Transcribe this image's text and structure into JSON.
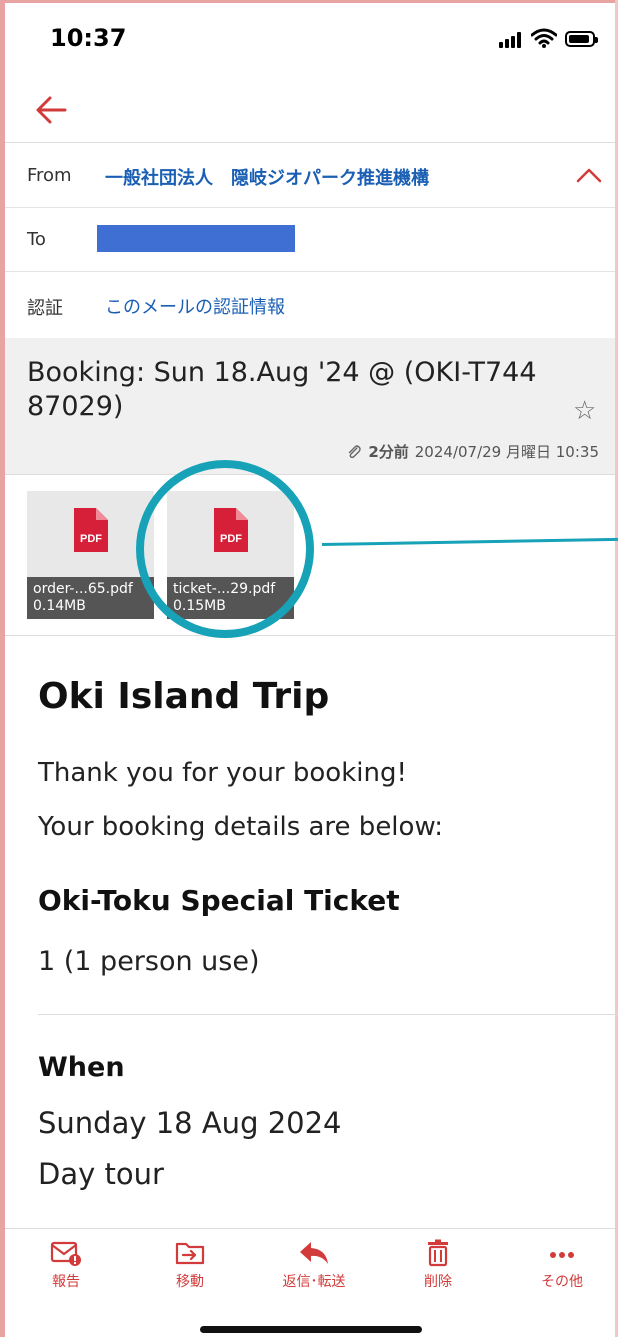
{
  "status_bar": {
    "time": "10:37"
  },
  "email_header": {
    "from_label": "From",
    "from_value": "一般社団法人　隠岐ジオパーク推進機構",
    "to_label": "To",
    "auth_label": "認証",
    "auth_link": "このメールの認証情報"
  },
  "subject": {
    "text": "Booking: Sun 18.Aug '24 @  (OKI-T74487029)",
    "time_ago": "2分前",
    "datetime": "2024/07/29 月曜日 10:35"
  },
  "attachments": [
    {
      "icon_label": "PDF",
      "name": "order-...65.pdf",
      "size": "0.14MB"
    },
    {
      "icon_label": "PDF",
      "name": "ticket-...29.pdf",
      "size": "0.15MB"
    }
  ],
  "body": {
    "title": "Oki Island Trip",
    "thanks": "Thank you for your booking!",
    "details_intro": "Your booking details are below:",
    "ticket_name": "Oki-Toku Special Ticket",
    "quantity": "1 (1 person use)",
    "when_heading": "When",
    "date": "Sunday 18 Aug 2024",
    "tour_type": "Day tour"
  },
  "toolbar": [
    {
      "label": "報告",
      "icon": "report-mail-icon"
    },
    {
      "label": "移動",
      "icon": "move-folder-icon"
    },
    {
      "label": "返信･転送",
      "icon": "reply-icon"
    },
    {
      "label": "削除",
      "icon": "trash-icon"
    },
    {
      "label": "その他",
      "icon": "more-dots-icon"
    }
  ],
  "colors": {
    "accent": "#d23b3b",
    "link": "#1a5fb4",
    "highlight": "#17a2b8"
  }
}
